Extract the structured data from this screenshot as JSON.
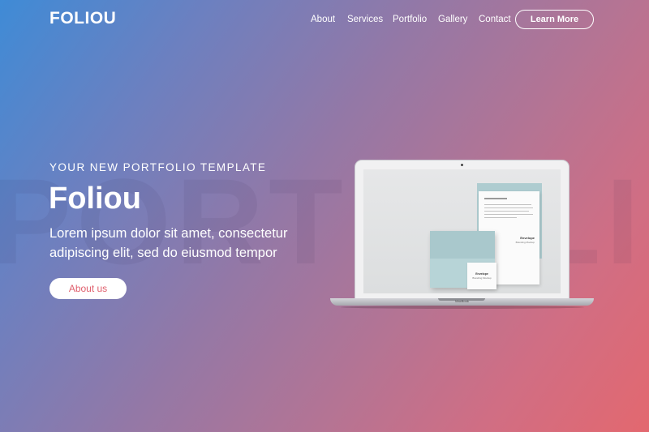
{
  "background_word": "PORTFOLIO",
  "brand": {
    "logo": "FOLIOU"
  },
  "nav": {
    "items": [
      {
        "label": "About"
      },
      {
        "label": "Services"
      },
      {
        "label": "Portfolio"
      },
      {
        "label": "Gallery"
      },
      {
        "label": "Contact"
      }
    ],
    "cta_label": "Learn More"
  },
  "hero": {
    "kicker": "YOUR NEW PORTFOLIO TEMPLATE",
    "title": "Foliou",
    "subtitle": "Lorem ipsum dolor sit amet, consectetur adipiscing elit, sed do eiusmod tempor",
    "button_label": "About us"
  },
  "mockup": {
    "laptop_brand": "MacBook",
    "letter_title": "Envelope",
    "letter_subtitle": "Branding Mockup",
    "card_title": "Envelope",
    "card_subtitle": "Branding Mockup"
  },
  "colors": {
    "gradient_start": "#3f8bd6",
    "gradient_end": "#e3686f",
    "accent": "#e0606e"
  }
}
